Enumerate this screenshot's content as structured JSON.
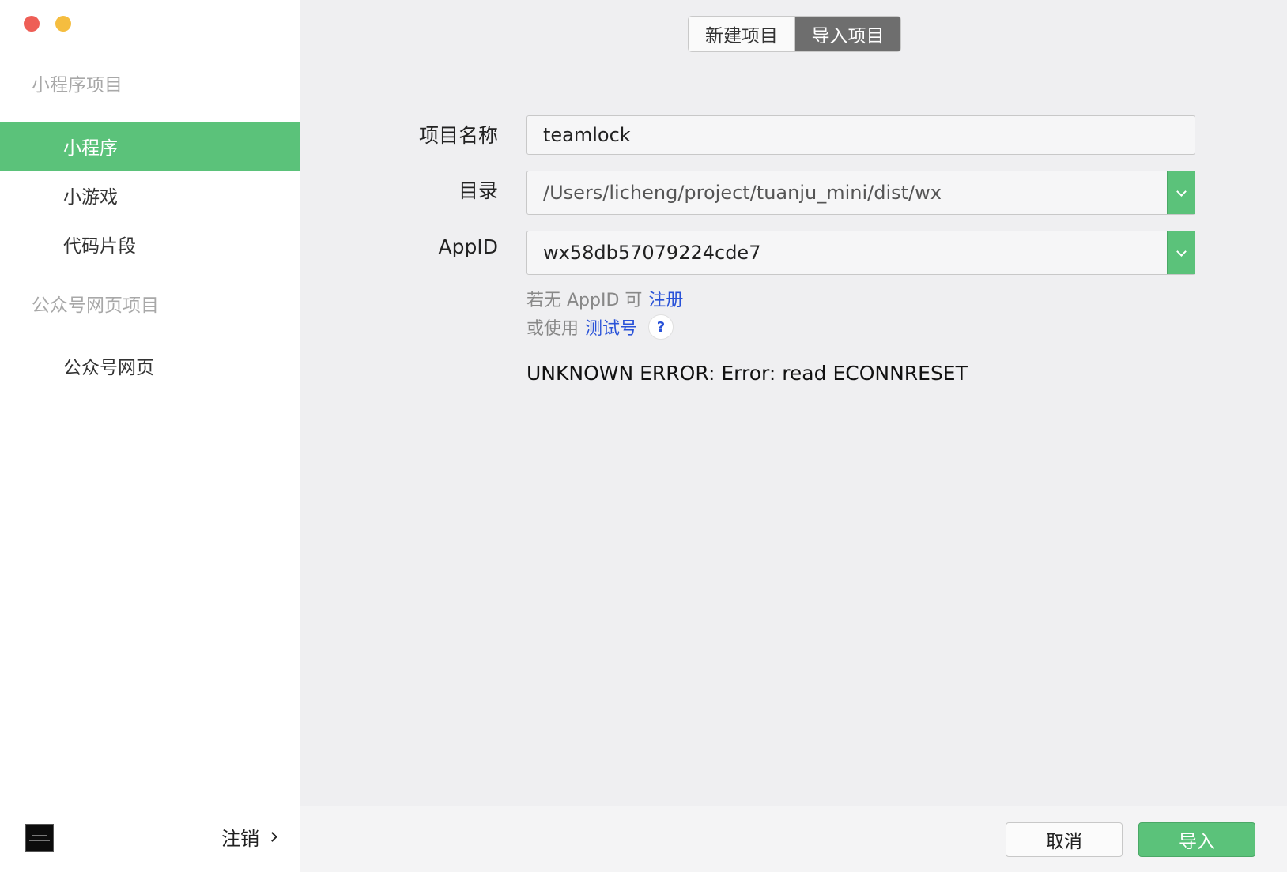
{
  "window": {
    "traffic_lights": {
      "close_color": "#ee5e56",
      "minimize_color": "#f5bd3f"
    }
  },
  "sidebar": {
    "sections": [
      {
        "title": "小程序项目",
        "items": [
          {
            "label": "小程序",
            "active": true
          },
          {
            "label": "小游戏",
            "active": false
          },
          {
            "label": "代码片段",
            "active": false
          }
        ]
      },
      {
        "title": "公众号网页项目",
        "items": [
          {
            "label": "公众号网页",
            "active": false
          }
        ]
      }
    ],
    "logout_label": "注销"
  },
  "tabs": [
    {
      "label": "新建项目",
      "active": false
    },
    {
      "label": "导入项目",
      "active": true
    }
  ],
  "form": {
    "project_name": {
      "label": "项目名称",
      "value": "teamlock"
    },
    "directory": {
      "label": "目录",
      "value": "/Users/licheng/project/tuanju_mini/dist/wx"
    },
    "appid": {
      "label": "AppID",
      "value": "wx58db57079224cde7"
    },
    "hint_register": {
      "prefix": "若无 AppID 可",
      "link": "注册"
    },
    "hint_test": {
      "prefix": "或使用",
      "link": "测试号",
      "help": "?"
    },
    "error": "UNKNOWN ERROR: Error: read ECONNRESET"
  },
  "footer": {
    "cancel_label": "取消",
    "import_label": "导入"
  },
  "colors": {
    "accent_green": "#5bc27a",
    "link_blue": "#2952d8",
    "segment_active": "#6e6e6e"
  }
}
